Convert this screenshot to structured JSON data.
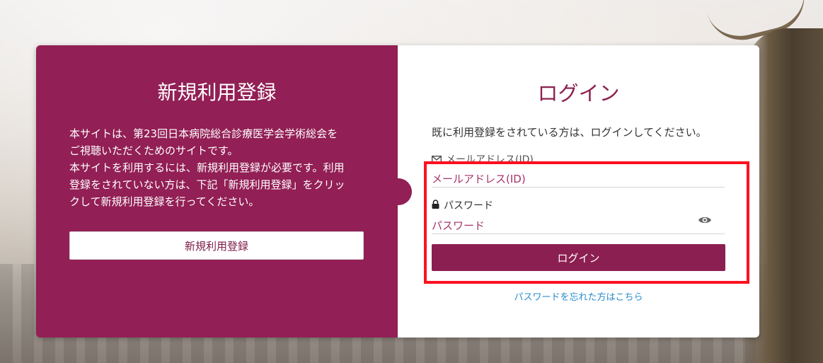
{
  "register": {
    "title": "新規利用登録",
    "description": [
      "本サイトは、第23回日本病院総合診療医学会学術総会を",
      "ご視聴いただくためのサイトです。",
      "本サイトを利用するには、新規利用登録が必要です。利用",
      "登録をされていない方は、下記「新規利用登録」をクリッ",
      "クして新規利用登録を行ってください。"
    ],
    "button_label": "新規利用登録"
  },
  "login": {
    "title": "ログイン",
    "intro": "既に利用登録をされている方は、ログインしてください。",
    "email_label": "メールアドレス(ID)",
    "email_placeholder": "メールアドレス(ID)",
    "email_value": "",
    "password_label": "パスワード",
    "password_placeholder": "パスワード",
    "password_value": "",
    "button_label": "ログイン",
    "forgot_link": "パスワードを忘れた方はこちら"
  },
  "icons": {
    "email": "envelope-icon",
    "password": "lock-icon",
    "show_password": "eye-icon"
  },
  "colors": {
    "brand": "#921f55",
    "link": "#2a8ccb",
    "highlight": "#ff1020"
  }
}
